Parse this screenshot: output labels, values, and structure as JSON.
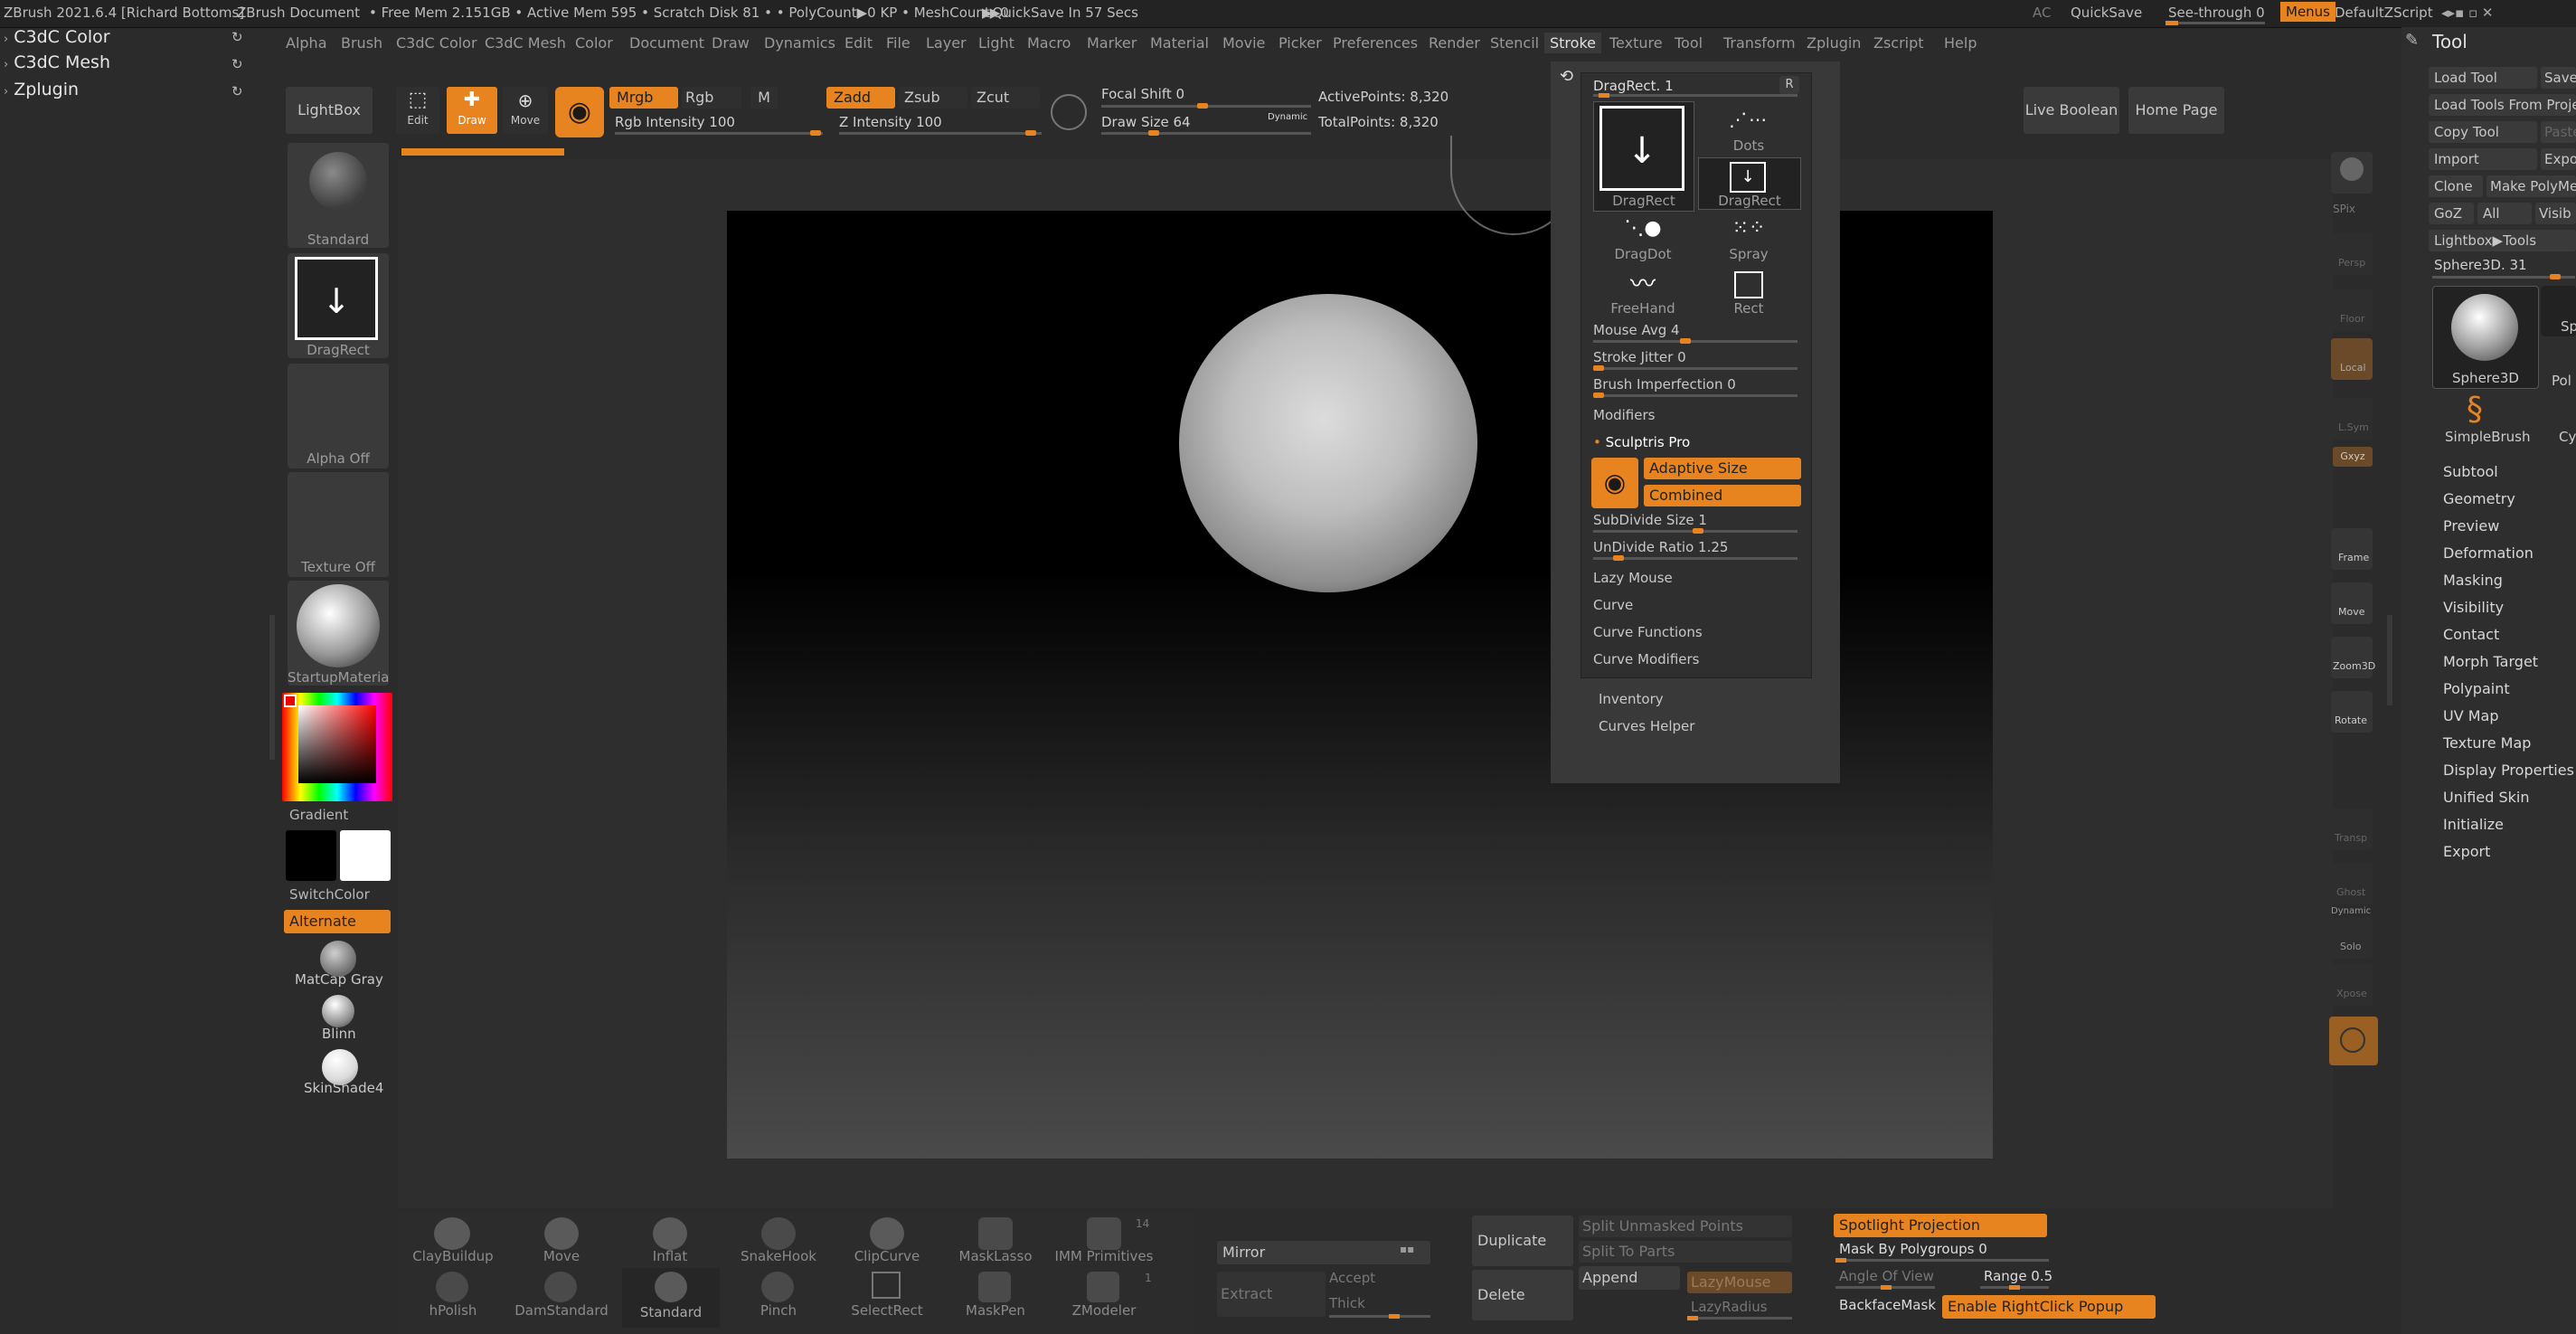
{
  "title_bar": {
    "app": "ZBrush 2021.6.4 [Richard Bottoms]",
    "doc": "ZBrush Document",
    "stats": "• Free Mem 2.151GB • Active Mem 595 • Scratch Disk 81 • • PolyCount▶0 KP • MeshCount▶0",
    "quicksave_timer": "▶QuickSave In 57 Secs",
    "ac": "AC",
    "quicksave": "QuickSave",
    "see_through": "See-through  0",
    "menus": "Menus",
    "default_zscript": "DefaultZScript"
  },
  "plugins_panel": {
    "items": [
      "C3dC Color",
      "C3dC Mesh",
      "Zplugin"
    ]
  },
  "menu": {
    "items": [
      "Alpha",
      "Brush",
      "C3dC Color",
      "C3dC Mesh",
      "Color",
      "Document",
      "Draw",
      "Dynamics",
      "Edit",
      "File",
      "Layer",
      "Light",
      "Macro",
      "Marker",
      "Material",
      "Movie",
      "Picker",
      "Preferences",
      "Render",
      "Stencil",
      "Stroke",
      "Texture",
      "Tool",
      "Transform",
      "Zplugin",
      "Zscript",
      "Help"
    ],
    "active": "Stroke"
  },
  "top_shelf": {
    "lightbox": "LightBox",
    "edit": "Edit",
    "draw": "Draw",
    "move": "Move",
    "mrgb": "Mrgb",
    "rgb": "Rgb",
    "m": "M",
    "rgb_intensity": "Rgb Intensity 100",
    "zadd": "Zadd",
    "zsub": "Zsub",
    "zcut": "Zcut",
    "z_intensity": "Z Intensity 100",
    "focal_shift": "Focal Shift 0",
    "draw_size": "Draw Size 64",
    "dynamic": "Dynamic",
    "active_points": "ActivePoints: 8,320",
    "total_points": "TotalPoints: 8,320",
    "live_boolean": "Live Boolean",
    "home_page": "Home Page"
  },
  "left_shelf": {
    "standard": "Standard",
    "dragrect": "DragRect",
    "alpha_off": "Alpha Off",
    "texture_off": "Texture Off",
    "startup_material": "StartupMaterial",
    "gradient": "Gradient",
    "switch_color": "SwitchColor",
    "alternate": "Alternate",
    "matcap_gray": "MatCap Gray",
    "blinn": "Blinn",
    "skinshade4": "SkinShade4"
  },
  "stroke_panel": {
    "title": "DragRect. 1",
    "r": "R",
    "strokes": [
      {
        "label": "DragRect"
      },
      {
        "label": "Dots"
      },
      {
        "label": "DragRect"
      },
      {
        "label": "DragDot"
      },
      {
        "label": "Spray"
      },
      {
        "label": "FreeHand"
      },
      {
        "label": "Rect"
      }
    ],
    "mouse_avg": "Mouse Avg 4",
    "stroke_jitter": "Stroke Jitter 0",
    "brush_imperfection": "Brush Imperfection 0",
    "modifiers": "Modifiers",
    "sculptris_pro": "Sculptris Pro",
    "adaptive_size": "Adaptive Size",
    "combined": "Combined",
    "subdivide_size": "SubDivide Size 1",
    "undivide_ratio": "UnDivide Ratio 1.25",
    "lazy_mouse": "Lazy Mouse",
    "curve": "Curve",
    "curve_functions": "Curve Functions",
    "curve_modifiers": "Curve Modifiers",
    "inventory": "Inventory",
    "curves_helper": "Curves Helper"
  },
  "right_toolbar": {
    "spix": "SPix",
    "persp": "Persp",
    "floor": "Floor",
    "local": "Local",
    "lsym": "L.Sym",
    "gxyz": "Gxyz",
    "frame": "Frame",
    "move": "Move",
    "zoom3d": "Zoom3D",
    "rotate": "Rotate",
    "transp": "Transp",
    "ghost": "Ghost",
    "dynamic": "Dynamic",
    "solo": "Solo",
    "xpose": "Xpose"
  },
  "tool_panel": {
    "title": "Tool",
    "load_tool": "Load Tool",
    "save": "Save",
    "load_tools_from_project": "Load Tools From Proje",
    "copy_tool": "Copy Tool",
    "paste": "Paste",
    "import": "Import",
    "export_short": "Expo",
    "clone": "Clone",
    "make_polymesh": "Make PolyMe",
    "goz": "GoZ",
    "all": "All",
    "visible": "Visib",
    "lightbox_tools": "Lightbox▶Tools",
    "sphere3d_value": "Sphere3D. 31",
    "sphere3d": "Sphere3D",
    "simplebrush": "SimpleBrush",
    "poly_partial": "Pol",
    "cy_partial": "Cy",
    "sp_partial": "Sp",
    "items": [
      "Subtool",
      "Geometry",
      "Preview",
      "Deformation",
      "Masking",
      "Visibility",
      "Contact",
      "Morph Target",
      "Polypaint",
      "UV Map",
      "Texture Map",
      "Display Properties",
      "Unified Skin",
      "Initialize",
      "Export"
    ]
  },
  "bottom_brushes": {
    "items": [
      {
        "label": "ClayBuildup"
      },
      {
        "label": "Move"
      },
      {
        "label": "Inflat"
      },
      {
        "label": "SnakeHook"
      },
      {
        "label": "ClipCurve"
      },
      {
        "label": "MaskLasso"
      },
      {
        "label": "IMM Primitives"
      },
      {
        "label": "hPolish"
      },
      {
        "label": "DamStandard"
      },
      {
        "label": "Standard"
      },
      {
        "label": "Pinch"
      },
      {
        "label": "SelectRect"
      },
      {
        "label": "MaskPen"
      },
      {
        "label": "ZModeler"
      }
    ],
    "imm_count": "14",
    "zmodeler_count": "1"
  },
  "bottom_panel": {
    "mirror": "Mirror",
    "extract": "Extract",
    "accept": "Accept",
    "thick": "Thick",
    "duplicate": "Duplicate",
    "delete": "Delete",
    "split_unmasked_points": "Split Unmasked Points",
    "split_to_parts": "Split To Parts",
    "append": "Append",
    "lazy_mouse": "LazyMouse",
    "lazy_radius": "LazyRadius",
    "spotlight_projection": "Spotlight Projection",
    "mask_by_polygroups": "Mask By Polygroups 0",
    "angle_of_view": "Angle Of View",
    "range": "Range 0.5",
    "backface_mask": "BackfaceMask",
    "enable_rightclick_popup": "Enable RightClick Popup"
  },
  "colors": {
    "accent": "#e8841f",
    "background": "#2b2b2b",
    "panel": "#333333"
  }
}
